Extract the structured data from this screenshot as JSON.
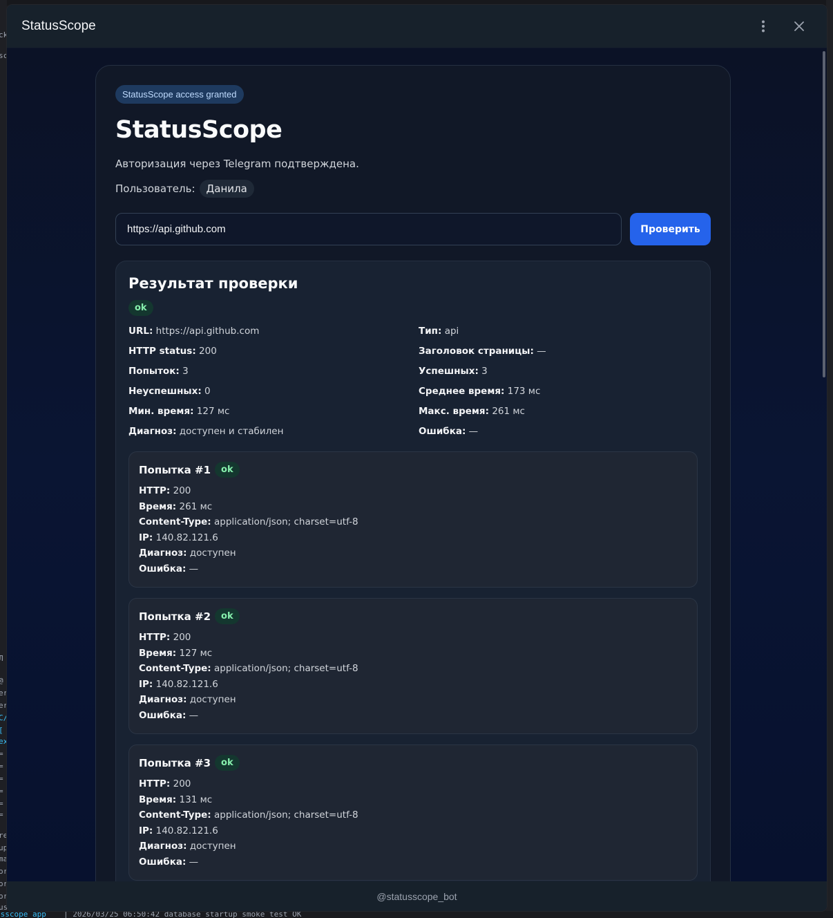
{
  "window": {
    "title": "StatusScope",
    "footer": "@statusscope_bot"
  },
  "card": {
    "badge": "StatusScope access granted",
    "title": "StatusScope",
    "auth_text": "Авторизация через Telegram подтверждена.",
    "user_label": "Пользователь:",
    "user_name": "Данила"
  },
  "check": {
    "url_value": "https://api.github.com",
    "button": "Проверить"
  },
  "result": {
    "title": "Результат проверки",
    "status": "ok",
    "summary": [
      {
        "key": "URL:",
        "value": "https://api.github.com"
      },
      {
        "key": "Тип:",
        "value": "api"
      },
      {
        "key": "HTTP status:",
        "value": "200"
      },
      {
        "key": "Заголовок страницы:",
        "value": "—"
      },
      {
        "key": "Попыток:",
        "value": "3"
      },
      {
        "key": "Успешных:",
        "value": "3"
      },
      {
        "key": "Неуспешных:",
        "value": "0"
      },
      {
        "key": "Среднее время:",
        "value": "173 мс"
      },
      {
        "key": "Мин. время:",
        "value": "127 мс"
      },
      {
        "key": "Макс. время:",
        "value": "261 мс"
      },
      {
        "key": "Диагноз:",
        "value": "доступен и стабилен"
      },
      {
        "key": "Ошибка:",
        "value": "—"
      }
    ],
    "attempts": [
      {
        "title": "Попытка #1",
        "status": "ok",
        "lines": [
          {
            "key": "HTTP:",
            "value": "200"
          },
          {
            "key": "Время:",
            "value": "261 мс"
          },
          {
            "key": "Content-Type:",
            "value": "application/json; charset=utf-8"
          },
          {
            "key": "IP:",
            "value": "140.82.121.6"
          },
          {
            "key": "Диагноз:",
            "value": "доступен"
          },
          {
            "key": "Ошибка:",
            "value": "—"
          }
        ]
      },
      {
        "title": "Попытка #2",
        "status": "ok",
        "lines": [
          {
            "key": "HTTP:",
            "value": "200"
          },
          {
            "key": "Время:",
            "value": "127 мс"
          },
          {
            "key": "Content-Type:",
            "value": "application/json; charset=utf-8"
          },
          {
            "key": "IP:",
            "value": "140.82.121.6"
          },
          {
            "key": "Диагноз:",
            "value": "доступен"
          },
          {
            "key": "Ошибка:",
            "value": "—"
          }
        ]
      },
      {
        "title": "Попытка #3",
        "status": "ok",
        "lines": [
          {
            "key": "HTTP:",
            "value": "200"
          },
          {
            "key": "Время:",
            "value": "131 мс"
          },
          {
            "key": "Content-Type:",
            "value": "application/json; charset=utf-8"
          },
          {
            "key": "IP:",
            "value": "140.82.121.6"
          },
          {
            "key": "Диагноз:",
            "value": "доступен"
          },
          {
            "key": "Ошибка:",
            "value": "—"
          }
        ]
      }
    ]
  },
  "background": {
    "terminal_line_prefix": "usscope_app",
    "terminal_line": "| 2026/03/25 06:50:42 database startup smoke test OK",
    "left_fragments": [
      "ck",
      "sc",
      "Л",
      "@",
      "er",
      "er",
      "C/",
      "[",
      "ex",
      "=",
      "=",
      "=",
      "=",
      "=",
      "=",
      "re",
      "up",
      "ma",
      "or",
      "or",
      "or",
      "us"
    ]
  },
  "colors": {
    "accent": "#2563eb",
    "ok_bg": "#14372f",
    "ok_text": "#86efac",
    "card_bg": "#111827",
    "titlebar_bg": "#17212b"
  },
  "icons": [
    "more-vertical-icon",
    "close-icon"
  ]
}
